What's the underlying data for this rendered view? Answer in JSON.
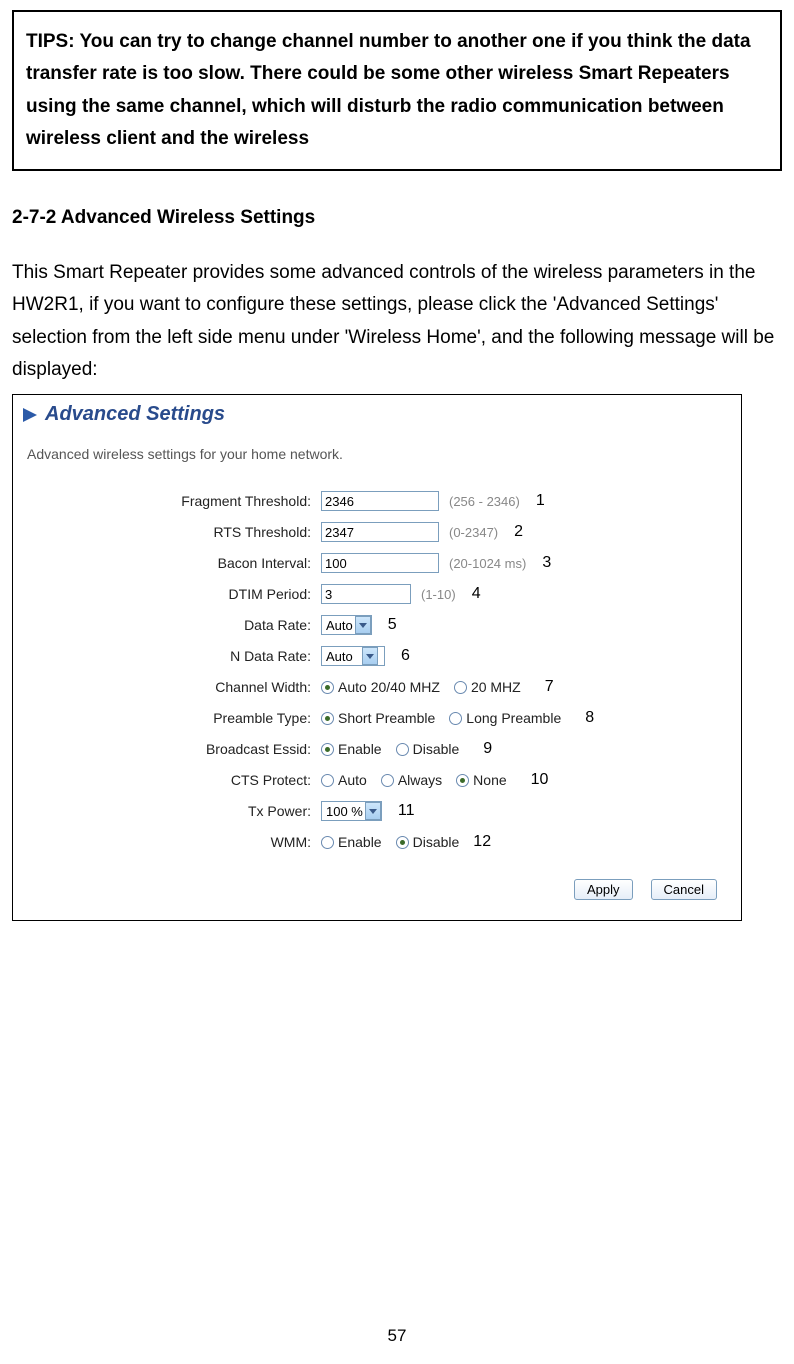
{
  "tips_text": "TIPS: You can try to change channel number to another one if you think the data transfer rate is too slow. There could be some other wireless Smart Repeaters using the same channel, which will disturb the radio communication between wireless client and the wireless",
  "section_heading": "2-7-2 Advanced Wireless Settings",
  "intro_text": "This Smart Repeater provides some advanced controls of the wireless parameters in the HW2R1, if you want to configure these settings, please click the 'Advanced Settings' selection from the left side menu under 'Wireless Home', and the following message will be displayed:",
  "panel": {
    "title": "Advanced Settings",
    "desc": "Advanced wireless settings for your home network."
  },
  "rows": {
    "fragment": {
      "label": "Fragment Threshold:",
      "value": "2346",
      "hint": "(256 - 2346)",
      "annot": "1"
    },
    "rts": {
      "label": "RTS Threshold:",
      "value": "2347",
      "hint": "(0-2347)",
      "annot": "2"
    },
    "bacon": {
      "label": "Bacon Interval:",
      "value": "100",
      "hint": "(20-1024 ms)",
      "annot": "3"
    },
    "dtim": {
      "label": "DTIM Period:",
      "value": "3",
      "hint": "(1-10)",
      "annot": "4"
    },
    "data_rate": {
      "label": "Data Rate:",
      "value": "Auto",
      "annot": "5"
    },
    "n_rate": {
      "label": "N Data Rate:",
      "value": "Auto",
      "annot": "6"
    },
    "chwidth": {
      "label": "Channel Width:",
      "opt1": "Auto 20/40 MHZ",
      "opt2": "20 MHZ",
      "annot": "7"
    },
    "preamble": {
      "label": "Preamble Type:",
      "opt1": "Short Preamble",
      "opt2": "Long Preamble",
      "annot": "8"
    },
    "bcast": {
      "label": "Broadcast Essid:",
      "opt1": "Enable",
      "opt2": "Disable",
      "annot": "9"
    },
    "cts": {
      "label": "CTS Protect:",
      "opt1": "Auto",
      "opt2": "Always",
      "opt3": "None",
      "annot": "10"
    },
    "txpower": {
      "label": "Tx Power:",
      "value": "100 %",
      "annot": "11"
    },
    "wmm": {
      "label": "WMM:",
      "opt1": "Enable",
      "opt2": "Disable",
      "annot": "12"
    }
  },
  "buttons": {
    "apply": "Apply",
    "cancel": "Cancel"
  },
  "page_number": "57"
}
